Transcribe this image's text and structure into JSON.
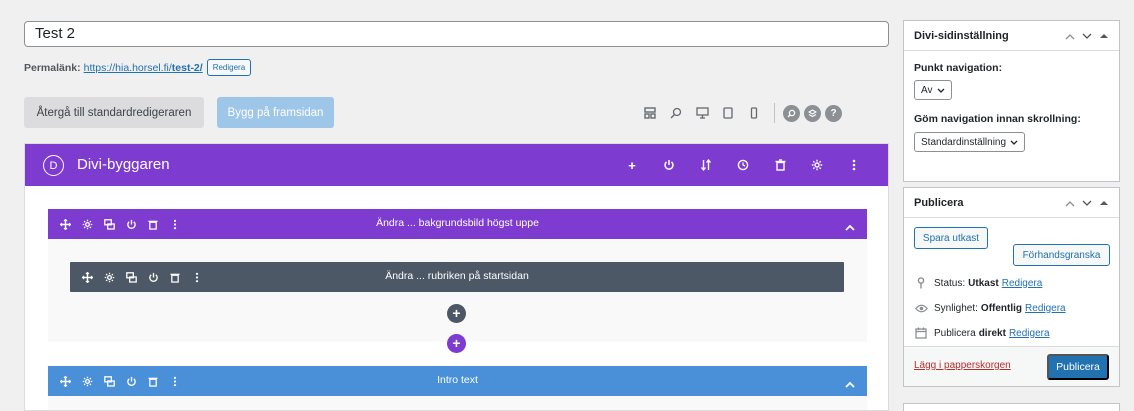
{
  "post": {
    "title": "Test 2",
    "permalink_label": "Permalänk:",
    "permalink_base": "https://hia.horsel.fi/",
    "permalink_slug": "test-2/",
    "edit_label": "Redigera"
  },
  "editor_bar": {
    "return_label": "Återgå till standardredigeraren",
    "front_label": "Bygg på framsidan",
    "icons": [
      "layout-icon",
      "zoom-icon",
      "desktop-icon",
      "tablet-icon",
      "phone-icon"
    ],
    "round_icons": [
      "search-icon",
      "layers-icon",
      "help-icon"
    ]
  },
  "divi": {
    "logo_letter": "D",
    "title": "Divi-byggaren",
    "head_actions": [
      "add-icon",
      "power-icon",
      "sort-icon",
      "history-icon",
      "trash-icon",
      "settings-icon",
      "more-icon"
    ],
    "sections": [
      {
        "title": "Ändra ... bakgrundsbild högst uppe",
        "color": "#7e3bd0",
        "rows": [
          {
            "title": "Ändra ... rubriken på startsidan",
            "color": "#4c5866"
          }
        ]
      },
      {
        "title": "Intro text",
        "color": "#4a90d9"
      }
    ]
  },
  "sidebar": {
    "divi_settings": {
      "title": "Divi-sidinställning",
      "nav_label": "Punkt navigation:",
      "nav_value": "Av",
      "hide_label": "Göm navigation innan skrollning:",
      "hide_value": "Standardinställning"
    },
    "publish": {
      "title": "Publicera",
      "save_draft": "Spara utkast",
      "preview": "Förhandsgranska",
      "status_label": "Status:",
      "status_value": "Utkast",
      "visibility_label": "Synlighet:",
      "visibility_value": "Offentlig",
      "publish_label": "Publicera",
      "publish_value": "direkt",
      "edit": "Redigera",
      "trash": "Lägg i papperskorgen",
      "publish_button": "Publicera"
    }
  },
  "colors": {
    "divi_purple": "#7e3bd0",
    "row_dark": "#4c5866",
    "section_blue": "#4a90d9",
    "wp_blue": "#2271b1"
  }
}
